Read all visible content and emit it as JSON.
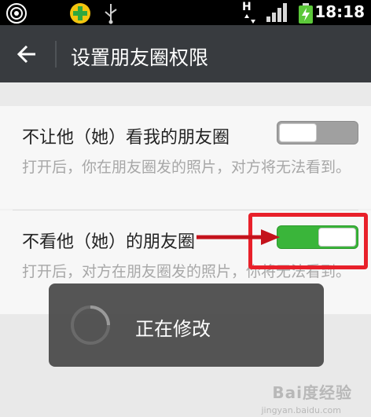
{
  "status_bar": {
    "clock": "18:18",
    "network_badge": "H",
    "icons": [
      "broadcast-icon",
      "security-app-icon",
      "usb-icon",
      "network-h-icon",
      "signal-icon",
      "battery-charging-icon"
    ]
  },
  "header": {
    "back_icon": "arrow-left-icon",
    "title": "设置朋友圈权限"
  },
  "settings": [
    {
      "title": "不让他（她）看我的朋友圈",
      "description": "打开后，你在朋友圈发的照片，对方将无法看到。",
      "enabled": false
    },
    {
      "title": "不看他（她）的朋友圈",
      "description": "打开后，对方在朋友圈发的照片，你将无法看到。",
      "enabled": true
    }
  ],
  "toast": {
    "text": "正在修改",
    "icon": "loading-spinner-icon"
  },
  "annotations": {
    "highlight_color": "#e8202a",
    "arrow_color": "#c4121b"
  },
  "watermark": {
    "text": "Bai度经验",
    "sub": "jingyan.baidu.com"
  },
  "colors": {
    "toggle_on": "#3ab53a",
    "toggle_off": "#a0a0a0",
    "header_bg": "#383b3f"
  }
}
